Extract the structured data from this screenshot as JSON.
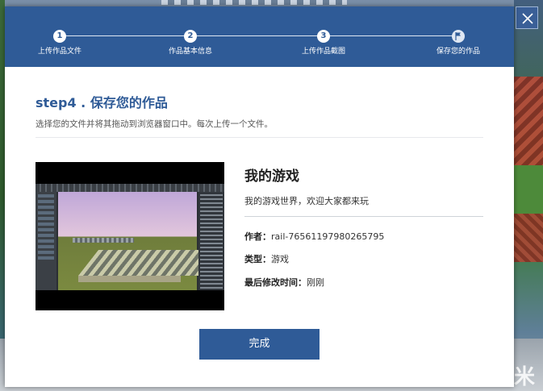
{
  "dialog": {
    "steps": [
      {
        "number": "1",
        "label": "上传作品文件"
      },
      {
        "number": "2",
        "label": "作品基本信息"
      },
      {
        "number": "3",
        "label": "上传作品截图"
      },
      {
        "number": "",
        "label": "保存您的作品",
        "icon": "flag-icon"
      }
    ],
    "current_step": 4,
    "title": "step4 . 保存您的作品",
    "description": "选择您的文件并将其拖动到浏览器窗口中。每次上传一个文件。",
    "work": {
      "title": "我的游戏",
      "description": "我的游戏世界，欢迎大家都来玩",
      "author_label": "作者：",
      "author_value": "rail-76561197980265795",
      "type_label": "类型：",
      "type_value": "游戏",
      "modified_label": "最后修改时间：",
      "modified_value": "刚刚"
    },
    "finish_label": "完成",
    "close_icon": "close-icon"
  },
  "background": {
    "logo_text": "米"
  },
  "colors": {
    "primary": "#2f5b97",
    "title": "#2f5b97",
    "white": "#ffffff"
  }
}
